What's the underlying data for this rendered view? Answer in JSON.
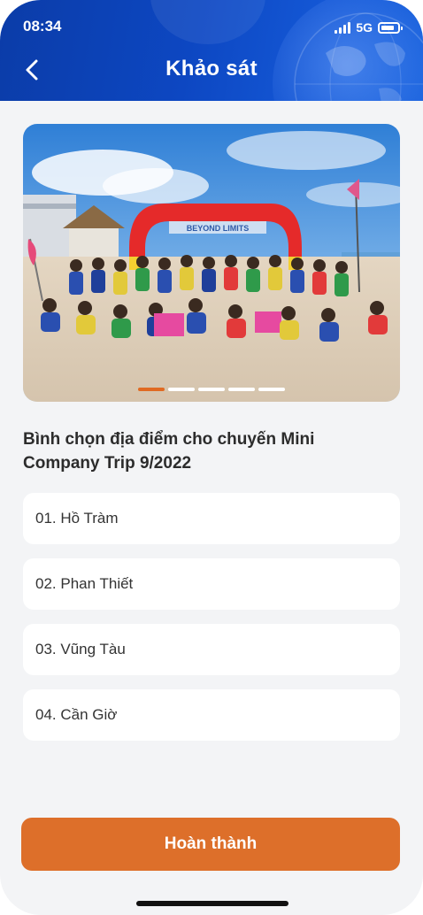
{
  "status_bar": {
    "time": "08:34",
    "network": "5G",
    "icons": [
      "signal-icon",
      "battery-icon"
    ]
  },
  "header": {
    "title": "Khảo sát",
    "back_icon": "chevron-left-icon"
  },
  "banner": {
    "slide_count": 5,
    "active_slide": 1,
    "arch_text": "BEYOND LIMITS",
    "colors": {
      "active_dot": "#e06a22",
      "inactive_dot": "#ffffff"
    }
  },
  "survey": {
    "question": "Bình chọn địa điểm cho chuyến Mini Company Trip 9/2022",
    "options": [
      {
        "label": "01. Hồ Tràm"
      },
      {
        "label": "02. Phan Thiết"
      },
      {
        "label": "03. Vũng Tàu"
      },
      {
        "label": "04. Cần Giờ"
      }
    ]
  },
  "actions": {
    "submit_label": "Hoàn thành"
  },
  "theme": {
    "header_blue": "#0d47c2",
    "accent_orange": "#dd6f2a",
    "page_background": "#f3f4f6"
  }
}
